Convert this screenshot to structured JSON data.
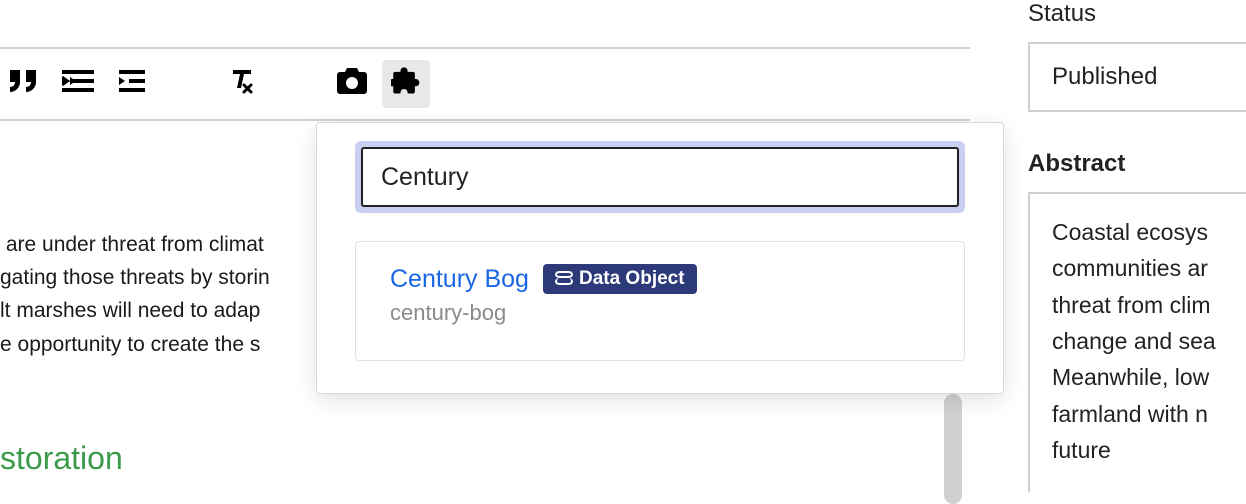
{
  "toolbar": {
    "icons": [
      "quote-icon",
      "outdent-icon",
      "indent-icon",
      "clear-format-icon",
      "camera-icon",
      "puzzle-icon"
    ]
  },
  "editor": {
    "body_fragment": " are under threat from climat\ngating those threats by storin\nlt marshes will need to adap\ne opportunity to create the s",
    "heading_fragment": "storation"
  },
  "popup": {
    "search_value": "Century",
    "result": {
      "title": "Century Bog",
      "badge": "Data Object",
      "slug": "century-bog"
    }
  },
  "sidebar": {
    "status_label": "Status",
    "status_value": "Published",
    "abstract_label": "Abstract",
    "abstract_fragment": "Coastal ecosys\ncommunities ar\nthreat from clim\nchange and sea\nMeanwhile, low\nfarmland with n\nfuture"
  }
}
